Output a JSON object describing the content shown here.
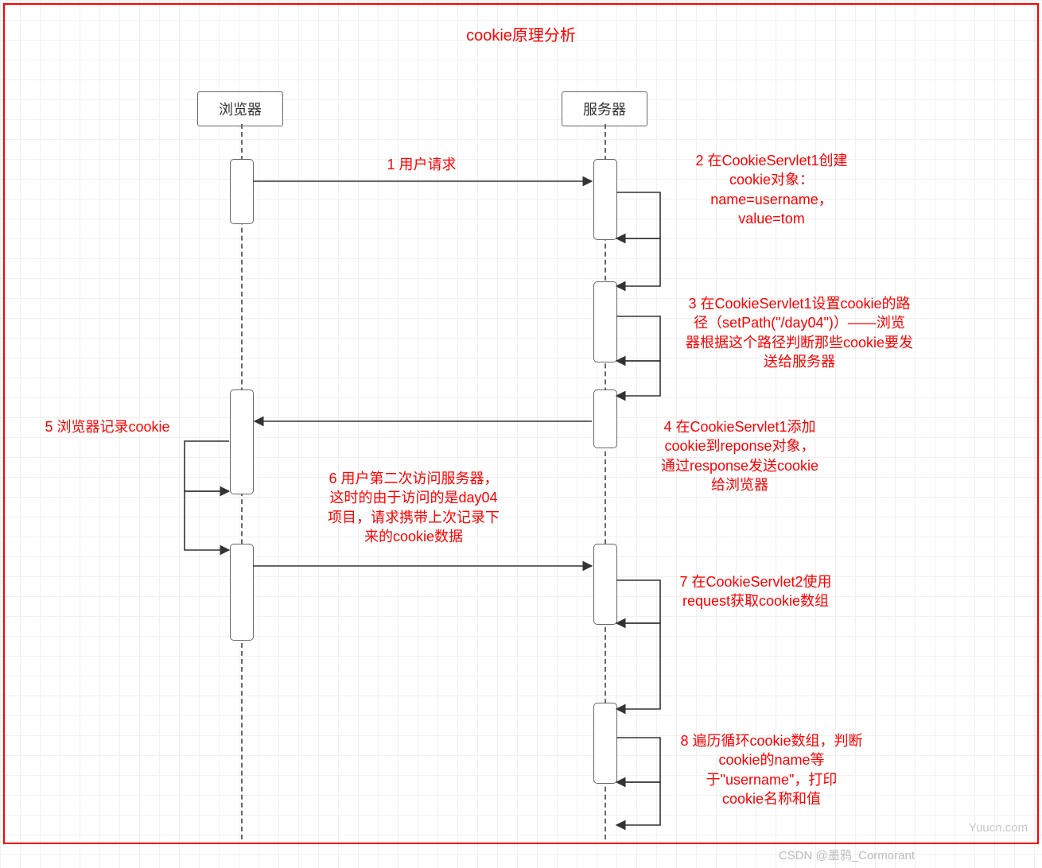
{
  "title": "cookie原理分析",
  "actors": {
    "browser": "浏览器",
    "server": "服务器"
  },
  "messages": {
    "m1": "1 用户请求",
    "m2": "2 在CookieServlet1创建\ncookie对象：\nname=username，\nvalue=tom",
    "m3": "3 在CookieServlet1设置cookie的路\n径（setPath(\"/day04\")）——浏览\n器根据这个路径判断那些cookie要发\n送给服务器",
    "m4": "4 在CookieServlet1添加\ncookie到reponse对象，\n通过response发送cookie\n给浏览器",
    "m5": "5 浏览器记录cookie",
    "m6": "6 用户第二次访问服务器，\n这时的由于访问的是day04\n项目，请求携带上次记录下\n来的cookie数据",
    "m7": "7 在CookieServlet2使用\nrequest获取cookie数组",
    "m8": "8 遍历循环cookie数组，判断\ncookie的name等\n于\"username\"，打印\ncookie名称和值"
  },
  "watermark1": "Yuucn.com",
  "watermark2": "CSDN @墨鸦_Cormorant"
}
